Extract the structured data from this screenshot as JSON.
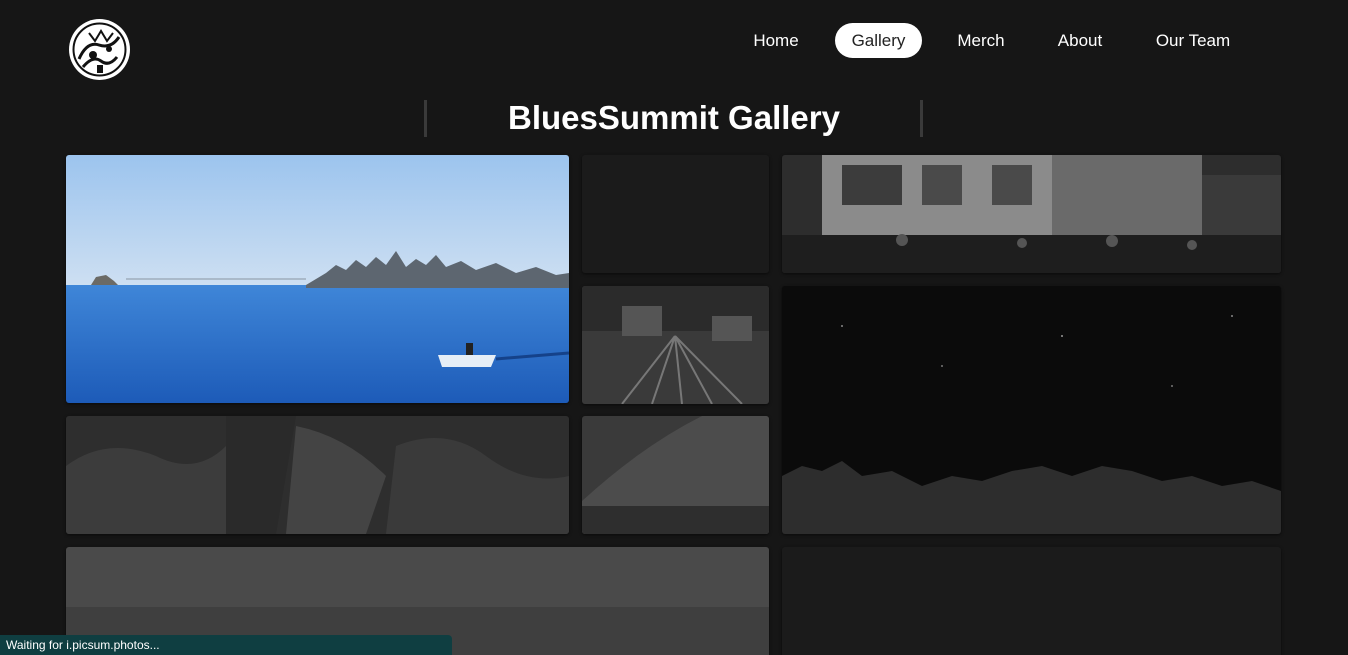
{
  "header": {
    "logo_icon": "bluessummit-logo-icon",
    "nav": [
      {
        "label": "Home",
        "active": false
      },
      {
        "label": "Gallery",
        "active": true
      },
      {
        "label": "Merch",
        "active": false
      },
      {
        "label": "About",
        "active": false
      },
      {
        "label": "Our Team",
        "active": false
      }
    ]
  },
  "main": {
    "title": "BluesSummit Gallery"
  },
  "gallery": {
    "tiles": [
      {
        "name": "gallery-photo-bay-boat"
      },
      {
        "name": "gallery-photo-loading-1"
      },
      {
        "name": "gallery-photo-city-crowd"
      },
      {
        "name": "gallery-photo-railway"
      },
      {
        "name": "gallery-photo-night-sky"
      },
      {
        "name": "gallery-photo-rocks"
      },
      {
        "name": "gallery-photo-rock-slope"
      },
      {
        "name": "gallery-photo-beach"
      },
      {
        "name": "gallery-photo-loading-2"
      }
    ]
  },
  "status": {
    "text": "Waiting for i.picsum.photos..."
  },
  "colors": {
    "background": "#161616",
    "active_nav_bg": "#ffffff",
    "status_bg": "#0f3e41"
  }
}
